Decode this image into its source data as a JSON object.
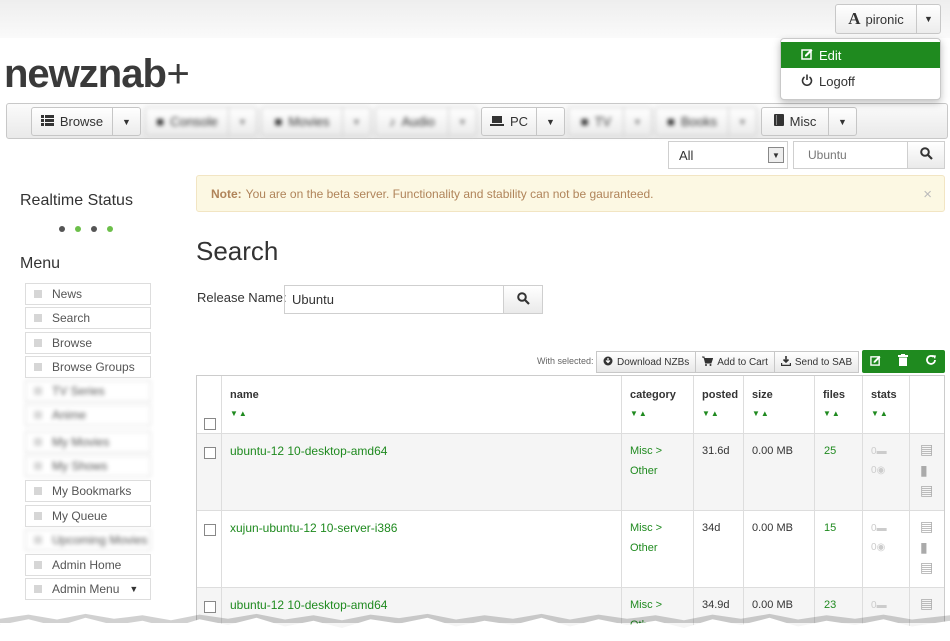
{
  "user": {
    "name": "pironic",
    "menu": [
      {
        "label": "Edit"
      },
      {
        "label": "Logoff"
      }
    ]
  },
  "logo": {
    "text": "newznab",
    "plus": "+"
  },
  "nav": [
    {
      "label": "Browse",
      "icon": "list-icon"
    },
    {
      "label": "Console",
      "icon": "gamepad-icon"
    },
    {
      "label": "Movies",
      "icon": "film-icon"
    },
    {
      "label": "Audio",
      "icon": "music-icon"
    },
    {
      "label": "PC",
      "icon": "laptop-icon"
    },
    {
      "label": "TV",
      "icon": "tv-icon"
    },
    {
      "label": "Books",
      "icon": "book-icon"
    },
    {
      "label": "Misc",
      "icon": "book-icon"
    }
  ],
  "topsearch": {
    "category": "All",
    "query": "Ubuntu"
  },
  "alert": {
    "strong": "Note:",
    "text": "You are on the beta server. Functionality and stability can not be gauranteed.",
    "close": "×"
  },
  "sidebar": {
    "realtime_title": "Realtime Status",
    "dot_colors": [
      "#555555",
      "#6cbf4a",
      "#555555",
      "#6cbf4a"
    ],
    "menu_title": "Menu",
    "items": [
      {
        "label": "News"
      },
      {
        "label": "Search"
      },
      {
        "label": "Browse"
      },
      {
        "label": "Browse Groups"
      },
      {
        "label": "TV Series"
      },
      {
        "label": "Anime"
      },
      {
        "label": "My Movies"
      },
      {
        "label": "My Shows"
      },
      {
        "label": "My Bookmarks"
      },
      {
        "label": "My Queue"
      },
      {
        "label": "Upcoming Movies"
      },
      {
        "label": "Admin Home"
      },
      {
        "label": "Admin Menu"
      }
    ]
  },
  "search": {
    "heading": "Search",
    "label": "Release Name:",
    "value": "Ubuntu",
    "with_selected": "With selected:",
    "actions": [
      {
        "label": "Download NZBs"
      },
      {
        "label": "Add to Cart"
      },
      {
        "label": "Send to SAB"
      }
    ]
  },
  "table": {
    "headers": [
      "name",
      "category",
      "posted",
      "size",
      "files",
      "stats"
    ],
    "rows": [
      {
        "name": "ubuntu-12 10-desktop-amd64",
        "cat1": "Misc >",
        "cat2": "Other",
        "posted": "31.6d",
        "size": "0.00 MB",
        "files": "25",
        "comments": "0",
        "grabs": "0"
      },
      {
        "name": "xujun-ubuntu-12 10-server-i386",
        "cat1": "Misc >",
        "cat2": "Other",
        "posted": "34d",
        "size": "0.00 MB",
        "files": "15",
        "comments": "0",
        "grabs": "0"
      },
      {
        "name": "ubuntu-12 10-desktop-amd64",
        "cat1": "Misc >",
        "cat2": "Other",
        "posted": "34.9d",
        "size": "0.00 MB",
        "files": "23",
        "comments": "0",
        "grabs": "0"
      }
    ]
  },
  "colors": {
    "accent": "#1f8a1f",
    "alert_bg": "#fcf8e3",
    "alert_text": "#b0845a"
  }
}
